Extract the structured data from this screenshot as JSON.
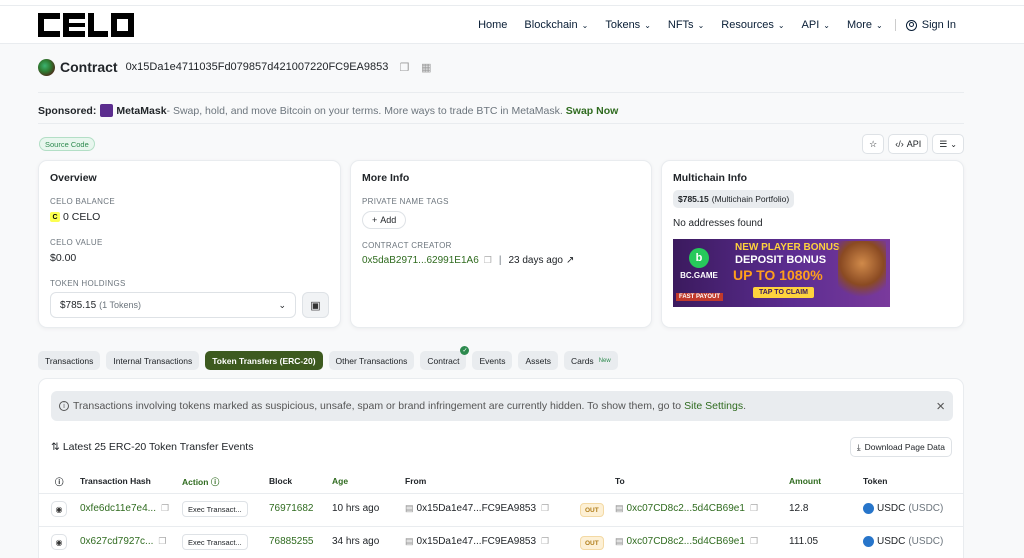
{
  "header": {
    "brand": "CELO",
    "nav": [
      {
        "label": "Home",
        "dropdown": false
      },
      {
        "label": "Blockchain",
        "dropdown": true
      },
      {
        "label": "Tokens",
        "dropdown": true
      },
      {
        "label": "NFTs",
        "dropdown": true
      },
      {
        "label": "Resources",
        "dropdown": true
      },
      {
        "label": "API",
        "dropdown": true
      },
      {
        "label": "More",
        "dropdown": true
      }
    ],
    "signin": "Sign In"
  },
  "title": {
    "label": "Contract",
    "address": "0x15Da1e4711035Fd079857d421007220FC9EA9853"
  },
  "sponsored": {
    "prefix": "Sponsored:",
    "brand": "MetaMask",
    "text": " - Swap, hold, and move Bitcoin on your terms. More ways to trade BTC in MetaMask.",
    "cta": "Swap Now"
  },
  "source_badge": "Source Code",
  "tools": {
    "api": "API"
  },
  "overview": {
    "title": "Overview",
    "balance_label": "CELO BALANCE",
    "balance_value": "0 CELO",
    "value_label": "CELO VALUE",
    "value_value": "$0.00",
    "holdings_label": "TOKEN HOLDINGS",
    "holdings_value": "$785.15",
    "holdings_count": "(1 Tokens)"
  },
  "more_info": {
    "title": "More Info",
    "tags_label": "PRIVATE NAME TAGS",
    "add_label": "Add",
    "creator_label": "CONTRACT CREATOR",
    "creator_address": "0x5daB2971...62991E1A6",
    "creator_age": "23 days ago"
  },
  "multichain": {
    "title": "Multichain Info",
    "portfolio_value": "$785.15",
    "portfolio_label": "(Multichain Portfolio)",
    "no_addresses": "No addresses found",
    "ad": {
      "brand": "BC.GAME",
      "line1": "NEW PLAYER BONUS",
      "line2": "DEPOSIT BONUS",
      "line3": "UP TO 1080%",
      "cta": "TAP TO CLAIM",
      "tag": "FAST PAYOUT"
    }
  },
  "tabs": [
    {
      "label": "Transactions",
      "active": false
    },
    {
      "label": "Internal Transactions",
      "active": false
    },
    {
      "label": "Token Transfers (ERC-20)",
      "active": true
    },
    {
      "label": "Other Transactions",
      "active": false
    },
    {
      "label": "Contract",
      "active": false,
      "verified": true
    },
    {
      "label": "Events",
      "active": false
    },
    {
      "label": "Assets",
      "active": false
    },
    {
      "label": "Cards",
      "active": false,
      "badge": "New"
    }
  ],
  "alert": {
    "text": "Transactions involving tokens marked as suspicious, unsafe, spam or brand infringement are currently hidden. To show them, go to ",
    "link": "Site Settings",
    "suffix": "."
  },
  "table": {
    "summary": "Latest 25 ERC-20 Token Transfer Events",
    "download": "Download Page Data",
    "headers": [
      "Transaction Hash",
      "Action",
      "Block",
      "Age",
      "From",
      "To",
      "Amount",
      "Token"
    ],
    "rows": [
      {
        "hash": "0xfe6dc11e7e4...",
        "action": "Exec Transact...",
        "block": "76971682",
        "age": "10 hrs ago",
        "from": "0x15Da1e47...FC9EA9853",
        "direction": "OUT",
        "to": "0xc07CD8c2...5d4CB69e1",
        "amount": "12.8",
        "token": "USDC",
        "token_symbol": "(USDC)"
      },
      {
        "hash": "0x627cd7927c...",
        "action": "Exec Transact...",
        "block": "76885255",
        "age": "34 hrs ago",
        "from": "0x15Da1e47...FC9EA9853",
        "direction": "OUT",
        "to": "0xc07CD8c2...5d4CB69e1",
        "amount": "111.05",
        "token": "USDC",
        "token_symbol": "(USDC)"
      }
    ]
  },
  "colors": {
    "accent_green": "#2f6b1f",
    "active_tab": "#3d5a1f",
    "out_badge": "#fdf0d5"
  }
}
